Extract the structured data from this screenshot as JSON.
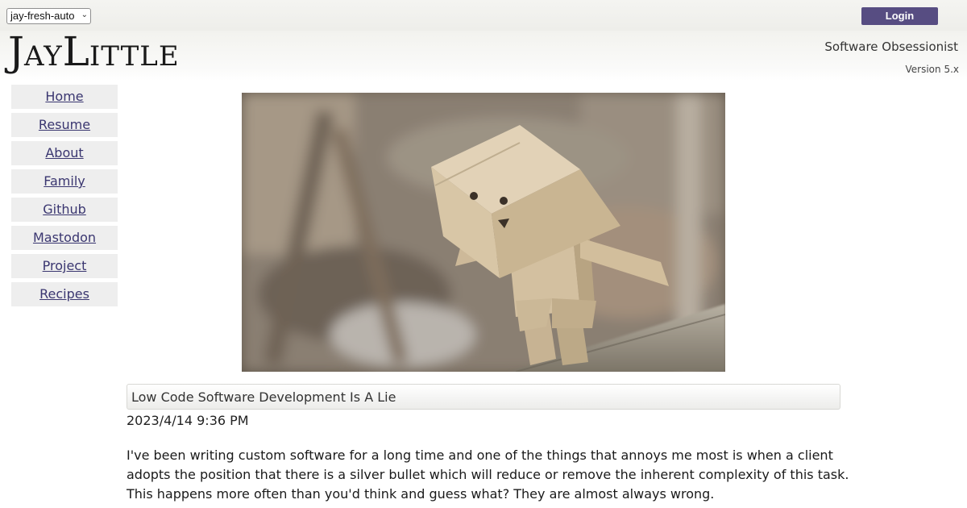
{
  "topbar": {
    "theme_select_value": "jay-fresh-auto",
    "login_label": "Login",
    "colors": {
      "login_bg": "#574d82"
    }
  },
  "header": {
    "logo_first_initial": "J",
    "logo_first_rest": "AY",
    "logo_last_initial": "L",
    "logo_last_rest": "ITTLE",
    "tagline": "Software Obsessionist",
    "version": "Version 5.x"
  },
  "sidebar": {
    "items": [
      {
        "label": "Home"
      },
      {
        "label": "Resume"
      },
      {
        "label": "About"
      },
      {
        "label": "Family"
      },
      {
        "label": "Github"
      },
      {
        "label": "Mastodon"
      },
      {
        "label": "Project"
      },
      {
        "label": "Recipes"
      }
    ],
    "colors": {
      "link": "#3a3670",
      "item_bg": "#eeeeee"
    }
  },
  "hero_image": {
    "icon": "cardboard-robot-photo"
  },
  "post": {
    "title": "Low Code Software Development Is A Lie",
    "date": "2023/4/14 9:36 PM",
    "body_lines": [
      "I've been writing custom software for a long time and one of the things that annoys me most is when a client",
      "adopts the position that there is a silver bullet which will reduce or remove the inherent complexity of this task.",
      "This happens more often than you'd think and guess what? They are almost always wrong."
    ]
  }
}
